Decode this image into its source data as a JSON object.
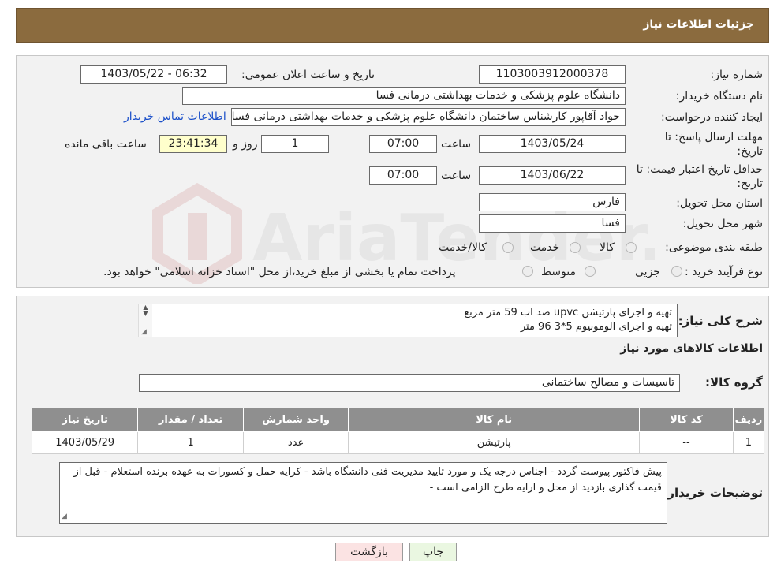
{
  "page_title": "جزئیات اطلاعات نیاز",
  "fields": {
    "need_number_label": "شماره نیاز:",
    "need_number": "1103003912000378",
    "announce_label": "تاریخ و ساعت اعلان عمومی:",
    "announce_value": "1403/05/22 - 06:32",
    "buyer_org_label": "نام دستگاه خریدار:",
    "buyer_org": "دانشگاه علوم پزشکی و خدمات بهداشتی درمانی فسا",
    "creator_label": "ایجاد کننده درخواست:",
    "creator": "جواد آقاپور کارشناس ساختمان دانشگاه علوم پزشکی و خدمات بهداشتی درمانی فسا",
    "contact_link": "اطلاعات تماس خریدار",
    "deadline_label_1": "مهلت ارسال پاسخ: تا",
    "deadline_label_2": "تاریخ:",
    "deadline_date": "1403/05/24",
    "time_label": "ساعت",
    "deadline_time": "07:00",
    "days_value": "1",
    "days_label": "روز و",
    "remaining_time": "23:41:34",
    "remaining_label": "ساعت باقی مانده",
    "validity_label_1": "حداقل تاریخ اعتبار قیمت: تا",
    "validity_label_2": "تاریخ:",
    "validity_date": "1403/06/22",
    "validity_time": "07:00",
    "province_label": "استان محل تحویل:",
    "province": "فارس",
    "city_label": "شهر محل تحویل:",
    "city": "فسا",
    "category_label": "طبقه بندی موضوعی:",
    "category_options": [
      "کالا",
      "خدمت",
      "کالا/خدمت"
    ],
    "process_label": "نوع فرآیند خرید :",
    "process_options": [
      "جزیی",
      "متوسط"
    ],
    "process_note": "پرداخت تمام یا بخشی از مبلغ خرید،از محل \"اسناد خزانه اسلامی\" خواهد بود."
  },
  "description": {
    "label": "شرح کلی نیاز:",
    "lines": [
      "تهیه و اجرای پارتیشن upvc ضد اب 59 متر مربع",
      "تهیه و اجرای الومونیوم 5*3    96 متر"
    ]
  },
  "goods_info_title": "اطلاعات کالاهای مورد نیاز",
  "goods_group_label": "گروه کالا:",
  "goods_group": "تاسیسات و مصالح ساختمانی",
  "table": {
    "headers": [
      "ردیف",
      "کد کالا",
      "نام کالا",
      "واحد شمارش",
      "تعداد / مقدار",
      "تاریخ نیاز"
    ],
    "rows": [
      [
        "1",
        "--",
        "پارتیشن",
        "عدد",
        "1",
        "1403/05/29"
      ]
    ]
  },
  "buyer_notes_label": "توضیحات خریدار:",
  "buyer_notes": "پیش فاکتور پیوست گردد - اجناس درجه یک و مورد تایید مدیریت فنی دانشگاه باشد - کرایه حمل و کسورات به عهده برنده استعلام - قبل از قیمت گذاری بازدید از محل و ارایه طرح الزامی است -",
  "buttons": {
    "print": "چاپ",
    "back": "بازگشت"
  },
  "watermark_text": "AriaTender.neT",
  "colors": {
    "header_bg": "#8b6b3e",
    "table_header_bg": "#8f8f8f",
    "highlight": "#ffffcc",
    "link": "#1a4fc9",
    "print_btn": "#eaf7e1",
    "back_btn": "#fbe3e3"
  }
}
